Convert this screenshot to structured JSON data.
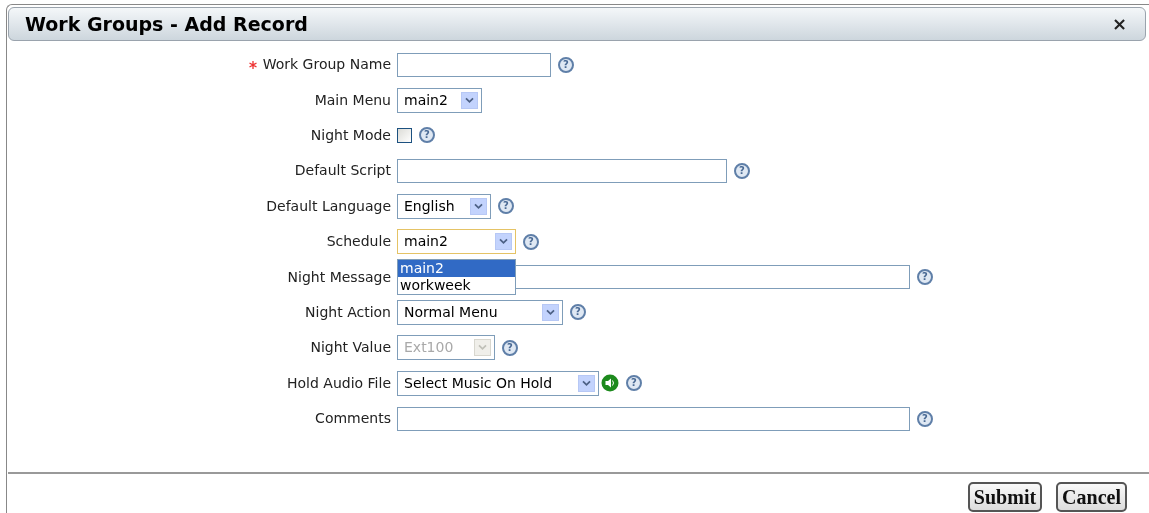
{
  "window": {
    "title": "Work Groups - Add Record",
    "close": "×"
  },
  "fields": [
    {
      "kind": "text",
      "label": "Work Group Name",
      "required": true,
      "help": "?"
    },
    {
      "kind": "select",
      "label": "Main Menu",
      "required": false,
      "value": "main2",
      "disabled": false
    },
    {
      "kind": "checkbox",
      "label": "Night Mode",
      "required": false,
      "checked": false,
      "help": "?"
    },
    {
      "kind": "text",
      "label": "Default Script",
      "required": false,
      "help": "?"
    },
    {
      "kind": "select",
      "label": "Default Language",
      "required": false,
      "value": "English",
      "disabled": false,
      "help": "?"
    },
    {
      "kind": "select",
      "label": "Schedule",
      "required": false,
      "value": "main2",
      "disabled": false,
      "focused": true,
      "help": "?",
      "options": [
        {
          "label": "main2",
          "selected": true
        },
        {
          "label": "workweek",
          "selected": false
        }
      ]
    },
    {
      "kind": "text",
      "label": "Night Message",
      "required": false,
      "help": "?"
    },
    {
      "kind": "select",
      "label": "Night Action",
      "required": false,
      "value": "Normal Menu",
      "disabled": false,
      "help": "?"
    },
    {
      "kind": "select",
      "label": "Night Value",
      "required": false,
      "value": "Ext100",
      "disabled": true,
      "help": "?"
    },
    {
      "kind": "audio",
      "label": "Hold Audio File",
      "required": false,
      "value": "Select Music On Hold",
      "disabled": false,
      "help": "?"
    },
    {
      "kind": "text",
      "label": "Comments",
      "required": false,
      "help": "?"
    }
  ],
  "buttons": [
    "Submit",
    "Cancel"
  ]
}
